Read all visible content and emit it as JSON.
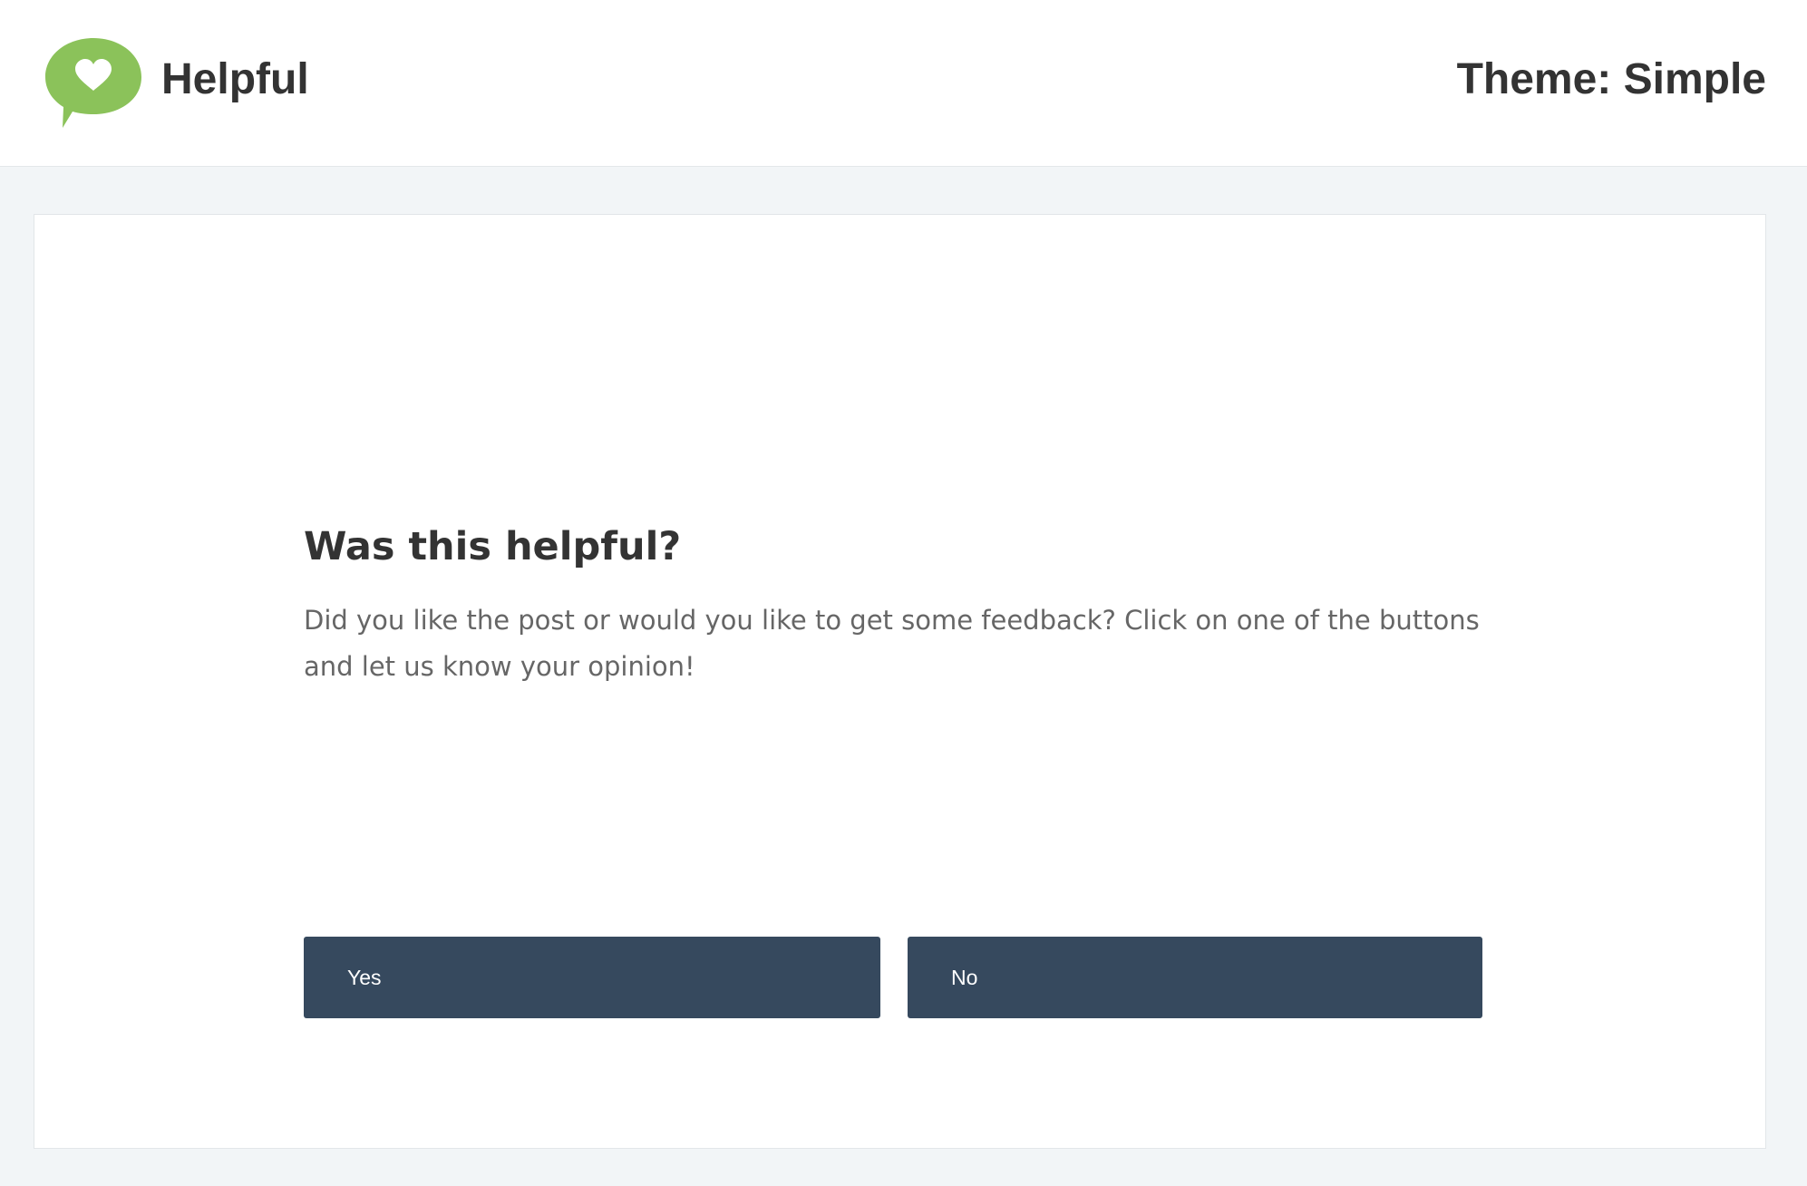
{
  "header": {
    "brand_name": "Helpful",
    "theme_label": "Theme: Simple",
    "logo_icon": "heart-speech-bubble-icon"
  },
  "feedback": {
    "title": "Was this helpful?",
    "text": "Did you like the post or would you like to get some feedback? Click on one of the buttons and let us know your opinion!",
    "yes_label": "Yes",
    "no_label": "No"
  },
  "colors": {
    "brand_green": "#8bc25a",
    "button_bg": "#36495e",
    "page_bg": "#f2f5f7",
    "heading_text": "#333333",
    "body_text": "#666666"
  }
}
